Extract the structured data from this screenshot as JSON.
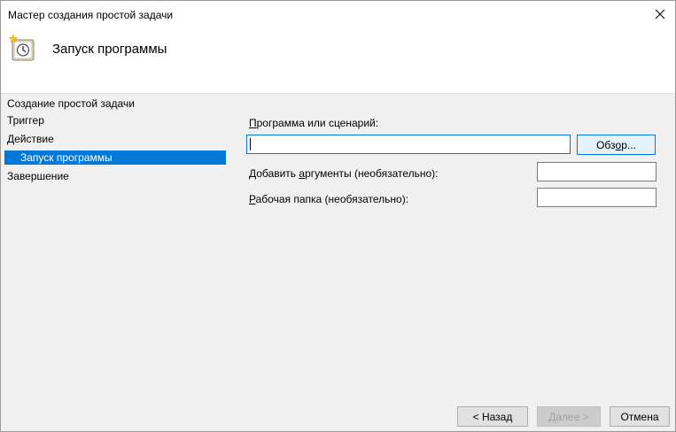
{
  "window": {
    "title": "Мастер создания простой задачи"
  },
  "header": {
    "title": "Запуск программы",
    "icon": "clock-task-icon"
  },
  "sidebar": {
    "items": [
      {
        "label": "Создание простой задачи",
        "selected": false
      },
      {
        "label": "Триггер",
        "selected": false
      },
      {
        "label": "Действие",
        "selected": false
      },
      {
        "label": "Запуск программы",
        "selected": true
      },
      {
        "label": "Завершение",
        "selected": false
      }
    ]
  },
  "form": {
    "program_label_u": "П",
    "program_label_rest": "рограмма или сценарий:",
    "program_value": "",
    "browse_label_pre": "Обз",
    "browse_label_u": "о",
    "browse_label_post": "р...",
    "args_label_pre": "Добавить ",
    "args_label_u": "а",
    "args_label_post": "ргументы (необязательно):",
    "args_value": "",
    "folder_label_u": "Р",
    "folder_label_rest": "абочая папка (необязательно):",
    "folder_value": ""
  },
  "footer": {
    "back_label": "< Назад",
    "next_label": "Далее >",
    "cancel_label": "Отмена"
  },
  "colors": {
    "accent": "#0078d7",
    "selected_text": "#ffffff"
  }
}
